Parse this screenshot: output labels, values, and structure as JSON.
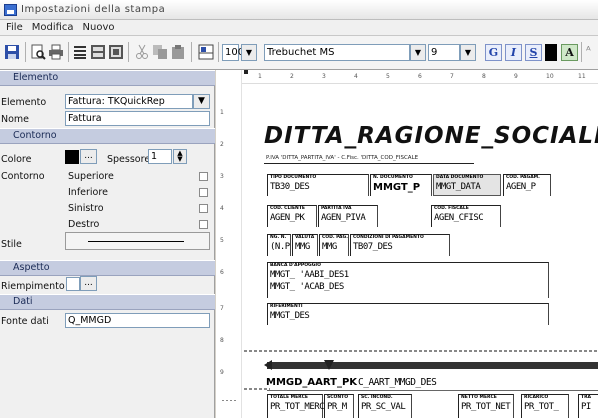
{
  "window": {
    "title": "Impostazioni della stampa"
  },
  "menu": {
    "items": [
      "File",
      "Modifica",
      "Nuovo"
    ]
  },
  "toolbar": {
    "zoom": "100",
    "font_name": "Trebuchet MS",
    "font_size": "9",
    "bold": "G",
    "italic": "I",
    "underline": "S",
    "text_color_swatch": "#000000",
    "fit_label": "A",
    "icons": [
      "save-icon",
      "preview-icon",
      "print-icon",
      "align-left-icon",
      "align-center-icon",
      "align-right-icon",
      "cut-icon",
      "copy-icon",
      "paste-icon",
      "grid-icon"
    ]
  },
  "panel": {
    "elemento_section": "Elemento",
    "elemento_label": "Elemento",
    "elemento_value": "Fattura: TKQuickRep",
    "nome_label": "Nome",
    "nome_value": "Fattura",
    "contorno_section": "Contorno",
    "colore_label": "Colore",
    "colore_swatch": "#000000",
    "ellipsis": "...",
    "spessore_label": "Spessore",
    "spessore_value": "1",
    "contorno_label": "Contorno",
    "borders": [
      "Superiore",
      "Inferiore",
      "Sinistro",
      "Destro"
    ],
    "stile_label": "Stile",
    "aspetto_section": "Aspetto",
    "riempimento_label": "Riempimento",
    "dati_section": "Dati",
    "fonte_label": "Fonte dati",
    "fonte_value": "Q_MMGD"
  },
  "report": {
    "ruler_h": [
      "1",
      "2",
      "3",
      "4",
      "5",
      "6",
      "7",
      "8",
      "9",
      "10",
      "11"
    ],
    "ruler_v": [
      "1",
      "2",
      "3",
      "4",
      "5",
      "6",
      "7",
      "8",
      "9"
    ],
    "title": "DITTA_RAGIONE_SOCIALE",
    "subline": "P.IVA 'DITTA_PARTITA_IVA' - C.Fisc. 'DITTA_COD_FISCALE",
    "boxes": [
      {
        "caption": "TIPO DOCUMENTO",
        "value": "TB30_DES"
      },
      {
        "caption": "N. DOCUMENTO",
        "value": "MMGT_P"
      },
      {
        "caption": "DATA DOCUMENTO",
        "value": "MMGT_DATA"
      },
      {
        "caption": "COD. PAGAM.",
        "value": "AGEN_P"
      },
      {
        "caption": "COD. CLIENTE",
        "value": "AGEN_PK"
      },
      {
        "caption": "PARTITA IVA",
        "value": "AGEN_PIVA"
      },
      {
        "caption": "COD. FISCALE",
        "value": "AGEN_CFISC"
      },
      {
        "caption": "NG. N.",
        "value": "(N.P"
      },
      {
        "caption": "VALUTA",
        "value": "MMG"
      },
      {
        "caption": "COD. PAG.",
        "value": "MMG"
      },
      {
        "caption": "CONDIZIONI DI PAGAMENTO",
        "value": "TB07_DES"
      },
      {
        "caption": "BANCA D'APPOGGIO",
        "value": "MMGT_ 'AABI_DES1"
      },
      {
        "caption": "",
        "value": "MMGT_ 'ACAB_DES"
      },
      {
        "caption": "RIFERIMENTI",
        "value": "MMGT_DES"
      }
    ],
    "detail_pk": "MMGD_AART_PK",
    "detail_des": "C_AART_MMGD_DES",
    "totals": [
      {
        "caption": "TOTALE MERCE",
        "value": "PR_TOT_MERC"
      },
      {
        "caption": "SCONTO",
        "value": "PR_M"
      },
      {
        "caption": "SC. INCOND.",
        "value": "PR_SC_VAL"
      },
      {
        "caption": "NETTO MERCE",
        "value": "PR_TOT_NET"
      },
      {
        "caption": "RICARICO",
        "value": "PR_TOT_"
      },
      {
        "caption": "TRA",
        "value": "PI"
      }
    ]
  }
}
